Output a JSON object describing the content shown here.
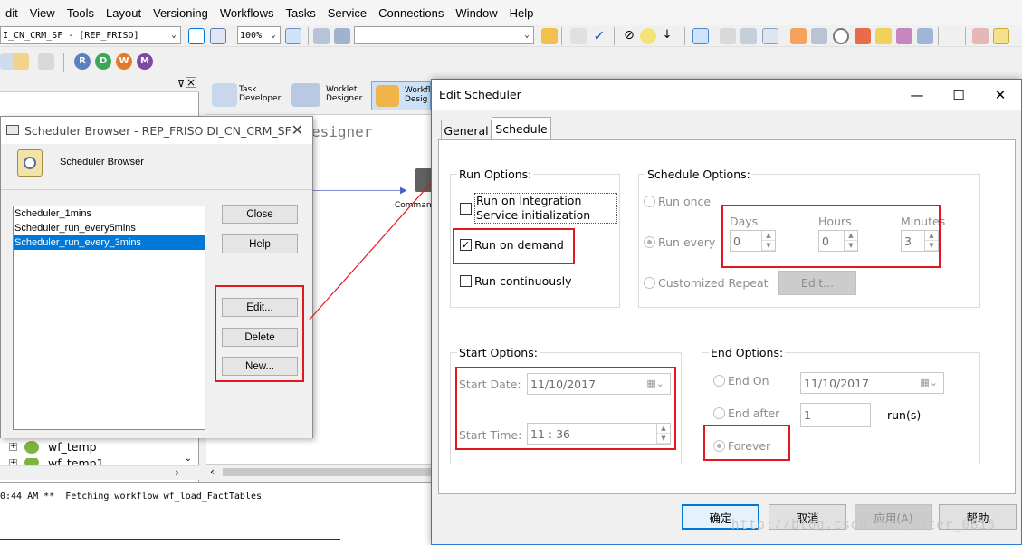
{
  "menu": [
    "dit",
    "View",
    "Tools",
    "Layout",
    "Versioning",
    "Workflows",
    "Tasks",
    "Service",
    "Connections",
    "Window",
    "Help"
  ],
  "toolbar": {
    "repo_combo": "I_CN_CRM_SF - [REP_FRISO]",
    "zoom_combo": "100%"
  },
  "designers": {
    "task": "Task\nDeveloper",
    "worklet": "Worklet\nDesigner",
    "workflow": "Workfl\nDesig"
  },
  "canvas": {
    "title": "esigner",
    "node_label": "Comman"
  },
  "tree": {
    "items": [
      {
        "label": "wf_temp"
      },
      {
        "label": "wf_temp1"
      }
    ]
  },
  "output": {
    "line": "0:44 AM **  Fetching workflow wf_load_FactTables"
  },
  "scheduler_browser": {
    "title": "Scheduler Browser - REP_FRISO DI_CN_CRM_SF",
    "header": "Scheduler Browser",
    "items": [
      "Scheduler_1mins",
      "Scheduler_run_every5mins",
      "Scheduler_run_every_3mins"
    ],
    "buttons": {
      "close": "Close",
      "help": "Help",
      "edit": "Edit...",
      "delete": "Delete",
      "new": "New..."
    }
  },
  "edit_scheduler": {
    "title": "Edit Scheduler",
    "tabs": [
      "General",
      "Schedule"
    ],
    "run_options": {
      "label": "Run Options:",
      "on_init": "Run on Integration Service initialization",
      "on_demand": "Run on demand",
      "continuously": "Run continuously"
    },
    "schedule_options": {
      "label": "Schedule Options:",
      "run_once": "Run once",
      "run_every": "Run every",
      "days_label": "Days",
      "days": "0",
      "hours_label": "Hours",
      "hours": "0",
      "minutes_label": "Minutes",
      "minutes": "3",
      "custom": "Customized Repeat",
      "edit": "Edit..."
    },
    "start_options": {
      "label": "Start Options:",
      "date_label": "Start Date:",
      "date": "11/10/2017",
      "time_label": "Start Time:",
      "time": "11 : 36"
    },
    "end_options": {
      "label": "End Options:",
      "end_on": "End On",
      "end_on_date": "11/10/2017",
      "end_after": "End after",
      "runs_value": "1",
      "runs_label": "run(s)",
      "forever": "Forever"
    },
    "footer": {
      "ok": "确定",
      "cancel": "取消",
      "apply": "应用(A)",
      "help": "帮助"
    }
  },
  "watermark": "http://blog.csdn.net/water_0815",
  "colors": {
    "accent": "#0078d7",
    "highlight": "#e0191e",
    "arrow": "#e0191e"
  }
}
